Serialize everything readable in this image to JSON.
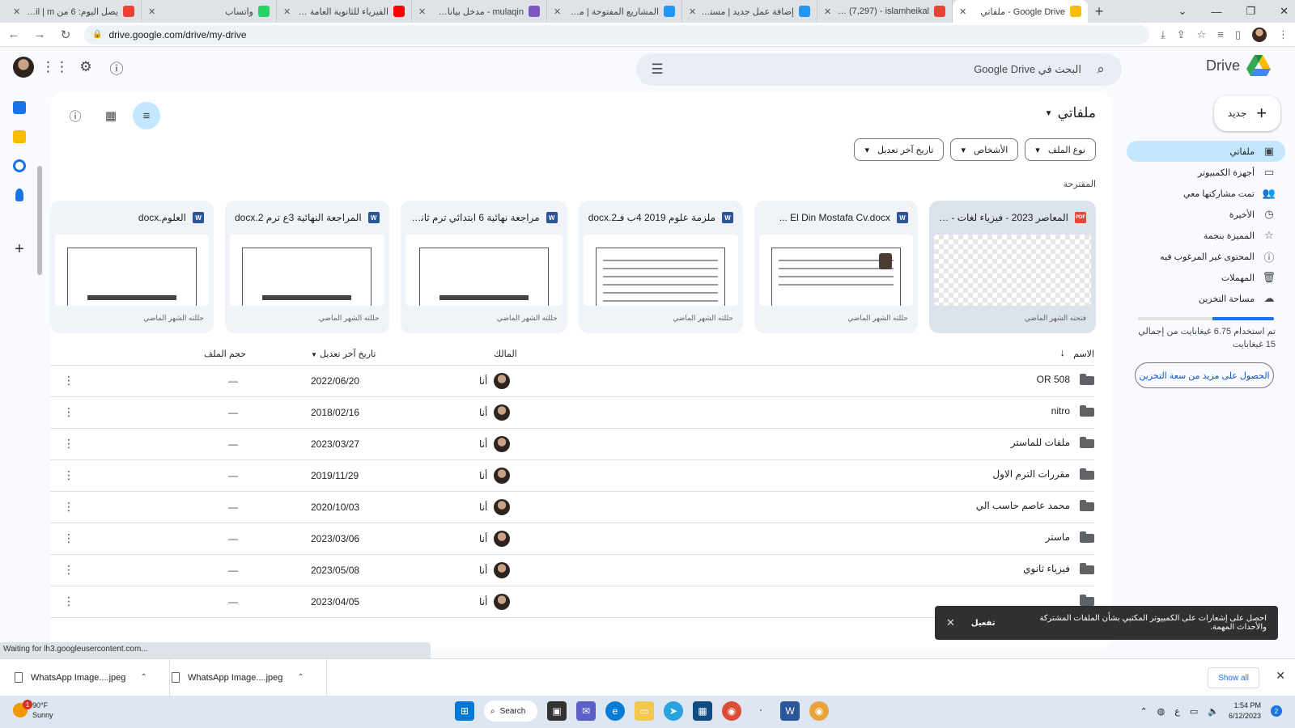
{
  "browser": {
    "tabs": [
      {
        "title": "يصل اليوم: 6 من Gmail | m",
        "icon": "gmail-icon",
        "active": false
      },
      {
        "title": "واتساب",
        "icon": "whatsapp-icon",
        "active": false
      },
      {
        "title": "الفيزياء للثانوية العامة 2021",
        "icon": "youtube-icon",
        "active": false
      },
      {
        "title": "mulaqin - مدخل بيانات | بيد",
        "icon": "mulaqin-icon",
        "active": false
      },
      {
        "title": "المشاريع المفتوحة | مستقل",
        "icon": "mostaql-icon",
        "active": false
      },
      {
        "title": "إضافة عمل جديد | مستقل",
        "icon": "mostaql-icon",
        "active": false
      },
      {
        "title": "Inbox (7,297) - islamheikal",
        "icon": "gmail-icon",
        "active": false
      },
      {
        "title": "Google Drive - ملفاتي",
        "icon": "drive-icon",
        "active": true
      }
    ],
    "url": "drive.google.com/drive/my-drive",
    "new_tab": "+",
    "status": "Waiting for lh3.googleusercontent.com..."
  },
  "header": {
    "search_placeholder": "البحث في Google Drive",
    "product_name": "Drive"
  },
  "nav": {
    "new_label": "جديد",
    "items": [
      {
        "label": "ملفاتي",
        "icon": "my-drive-icon",
        "active": true
      },
      {
        "label": "أجهزة الكمبيوتر",
        "icon": "computers-icon",
        "active": false
      },
      {
        "label": "تمت مشاركتها معي",
        "icon": "shared-icon",
        "active": false
      },
      {
        "label": "الأخيرة",
        "icon": "recent-icon",
        "active": false
      },
      {
        "label": "المميزة بنجمة",
        "icon": "star-icon",
        "active": false
      },
      {
        "label": "المحتوى غير المرغوب فيه",
        "icon": "spam-icon",
        "active": false
      },
      {
        "label": "المهملات",
        "icon": "trash-icon",
        "active": false
      },
      {
        "label": "مساحة التخزين",
        "icon": "cloud-icon",
        "active": false
      }
    ],
    "storage_used_fraction": 0.45,
    "storage_line1": "تم استخدام 6.75 غيغابايت من إجمالي",
    "storage_line2": "15 غيغابايت",
    "get_storage": "الحصول على مزيد من سعة التخزين"
  },
  "main": {
    "title": "ملفاتي",
    "filters": [
      "نوع الملف",
      "الأشخاص",
      "تاريخ آخر تعديل"
    ],
    "suggested_label": "المقترحة",
    "cards": [
      {
        "title": "المعاصر 2023 - فيزياء لغات - 1 ...",
        "type": "pdf",
        "footer": "فتحته الشهر الماضي",
        "thumb": "checker"
      },
      {
        "title": "El Din Mostafa Cv.docx ...",
        "type": "word",
        "footer": "حللته الشهر الماضي",
        "thumb": "cv"
      },
      {
        "title": "ملزمة علوم 2019 4ب فـ2.docx",
        "type": "word",
        "footer": "حللته الشهر الماضي",
        "thumb": "table"
      },
      {
        "title": "مراجعة نهائية 6 ابتدائي ترم ثاني.x...",
        "type": "word",
        "footer": "حللته الشهر الماضي",
        "thumb": "doc"
      },
      {
        "title": "المراجعة النهائية 3ع ترم 2.docx",
        "type": "word",
        "footer": "حللته الشهر الماضي",
        "thumb": "doc"
      },
      {
        "title": "العلوم.docx",
        "type": "word",
        "footer": "حللته الشهر الماضي",
        "thumb": "doc"
      }
    ],
    "table": {
      "headers": {
        "name": "الاسم",
        "owner": "المالك",
        "modified": "تاريخ آخر تعديل",
        "size": "حجم الملف"
      },
      "rows": [
        {
          "name": "OR 508",
          "owner": "أنا",
          "modified": "2022/06/20",
          "size": "—",
          "shared": true
        },
        {
          "name": "nitro",
          "owner": "أنا",
          "modified": "2018/02/16",
          "size": "—",
          "shared": false
        },
        {
          "name": "ملفات للماستر",
          "owner": "أنا",
          "modified": "2023/03/27",
          "size": "—",
          "shared": false
        },
        {
          "name": "مقررات الترم الاول",
          "owner": "أنا",
          "modified": "2019/11/29",
          "size": "—",
          "shared": false
        },
        {
          "name": "محمد عاصم حاسب الي",
          "owner": "أنا",
          "modified": "2020/10/03",
          "size": "—",
          "shared": false
        },
        {
          "name": "ماستر",
          "owner": "أنا",
          "modified": "2023/03/06",
          "size": "—",
          "shared": false
        },
        {
          "name": "فيزياء ثانوي",
          "owner": "أنا",
          "modified": "2023/05/08",
          "size": "—",
          "shared": false
        },
        {
          "name": "",
          "owner": "أنا",
          "modified": "2023/04/05",
          "size": "—",
          "shared": false
        }
      ]
    }
  },
  "snackbar": {
    "text": "احصل على إشعارات على الكمبيوتر المكتبي بشأن الملفات المشتركة والأحداث المهمة.",
    "action": "تفعيل"
  },
  "downloads": {
    "items": [
      "WhatsApp Image....jpeg",
      "WhatsApp Image....jpeg"
    ],
    "show_all": "Show all"
  },
  "taskbar": {
    "temp": "90°F",
    "condition": "Sunny",
    "weather_badge": "1",
    "search_label": "Search",
    "time": "1:54 PM",
    "date": "6/12/2023",
    "notifications": "2",
    "lang": "ع"
  },
  "colors": {
    "accent": "#0b57d0",
    "active_nav": "#c2e7ff",
    "page_bg": "#f8fafd"
  }
}
